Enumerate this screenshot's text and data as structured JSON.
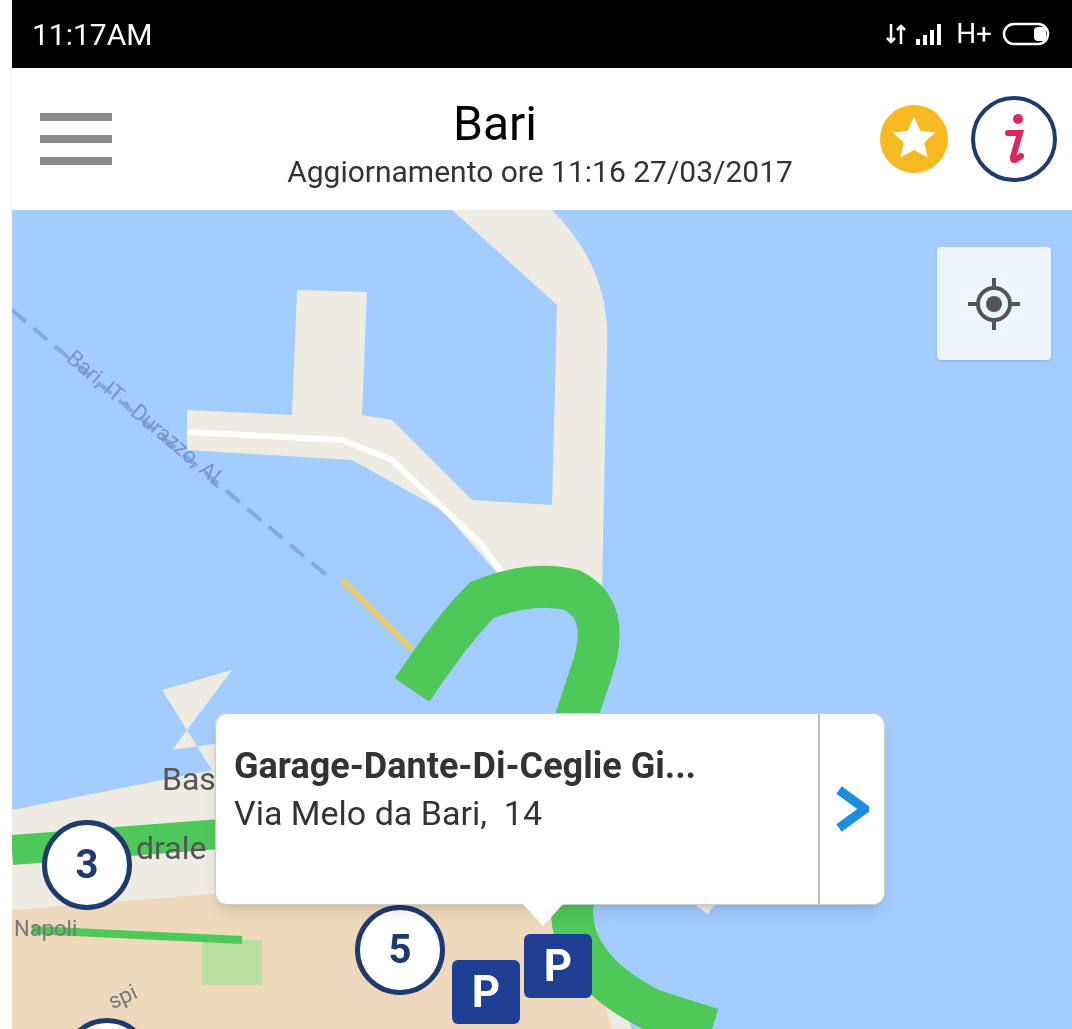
{
  "status_bar": {
    "time": "11:17AM",
    "network": "H+"
  },
  "header": {
    "title": "Bari",
    "subtitle": "Aggiornamento ore 11:16 27/03/2017"
  },
  "map": {
    "labels": [
      {
        "text": "Bari, IT - Durazzo, AL",
        "kind": "ferry"
      },
      {
        "text": "Bas",
        "kind": "place"
      },
      {
        "text": "drale",
        "kind": "place"
      },
      {
        "text": "Napoli",
        "kind": "street"
      },
      {
        "text": "spi",
        "kind": "street"
      }
    ],
    "clusters": [
      {
        "label": "3"
      },
      {
        "label": "5"
      }
    ],
    "parking": [
      {
        "label": "P"
      },
      {
        "label": "P"
      }
    ],
    "popup": {
      "title": "Garage-Dante-Di-Ceglie Gi...",
      "address": "Via Melo da Bari,  14"
    }
  }
}
